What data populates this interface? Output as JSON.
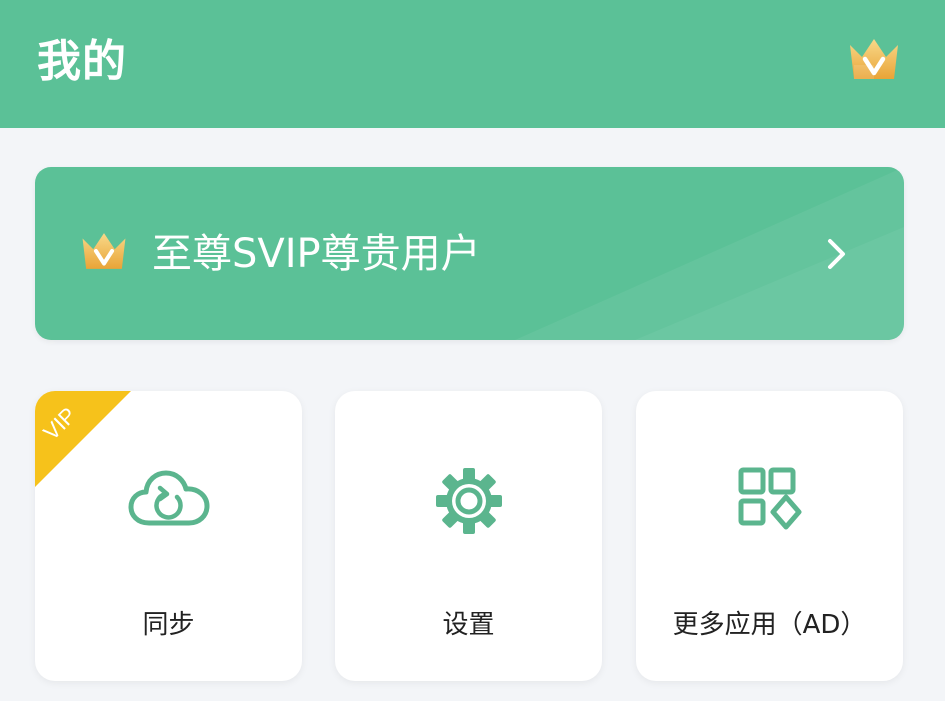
{
  "header": {
    "title": "我的",
    "crown_icon": "vip-crown-icon"
  },
  "svip_banner": {
    "label": "至尊SVIP尊贵用户",
    "crown_icon": "vip-crown-icon",
    "chevron_icon": "chevron-right-icon"
  },
  "cards": [
    {
      "label": "同步",
      "icon": "cloud-sync-icon",
      "badge": "VIP"
    },
    {
      "label": "设置",
      "icon": "gear-icon"
    },
    {
      "label": "更多应用（AD）",
      "icon": "apps-grid-icon"
    }
  ],
  "colors": {
    "accent": "#5bc197",
    "icon_green": "#5bb58e",
    "vip_badge": "#f6c21b",
    "crown_gold": "#f2b54a",
    "background": "#f3f5f8",
    "card": "#ffffff"
  }
}
